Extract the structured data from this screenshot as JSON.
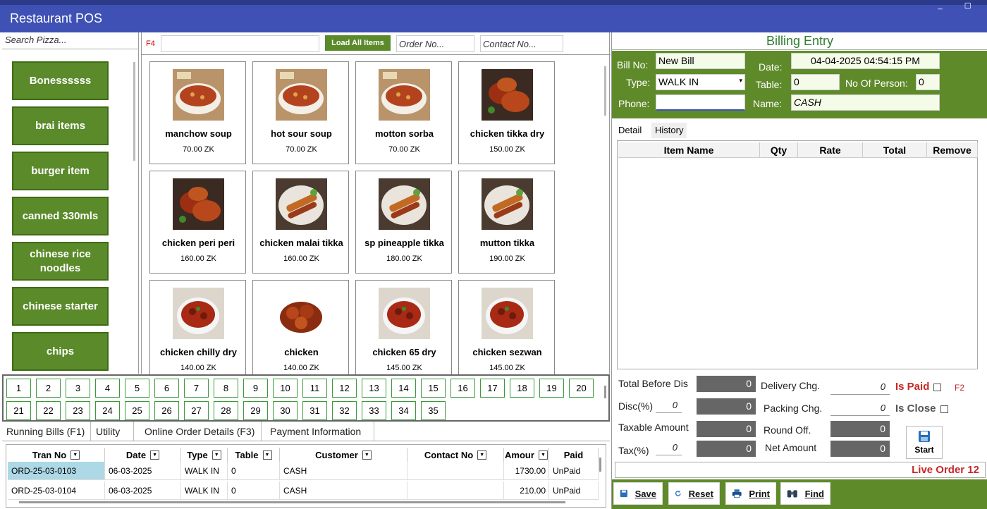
{
  "app": {
    "title": "Restaurant POS"
  },
  "categories": {
    "search_placeholder": "Search Pizza...",
    "items": [
      "Bonessssss",
      "brai items",
      "burger item",
      "canned 330mls",
      "chinese rice noodles",
      "chinese starter",
      "chips"
    ]
  },
  "items_toolbar": {
    "f4_label": "F4",
    "load_all_label": "Load All Items",
    "order_no_placeholder": "Order No...",
    "contact_no_placeholder": "Contact No..."
  },
  "menu_items": [
    {
      "name": "manchow soup",
      "price": "70.00 ZK",
      "icon": "soup-bowl"
    },
    {
      "name": "hot sour soup",
      "price": "70.00 ZK",
      "icon": "soup-bowl"
    },
    {
      "name": "motton sorba",
      "price": "70.00 ZK",
      "icon": "soup-bowl"
    },
    {
      "name": "chicken tikka dry",
      "price": "150.00 ZK",
      "icon": "grilled-chicken"
    },
    {
      "name": "chicken peri peri",
      "price": "160.00 ZK",
      "icon": "grilled-chicken"
    },
    {
      "name": "chicken malai tikka",
      "price": "160.00 ZK",
      "icon": "skewer-plate"
    },
    {
      "name": "sp pineapple tikka",
      "price": "180.00 ZK",
      "icon": "skewer-plate"
    },
    {
      "name": "mutton tikka",
      "price": "190.00 ZK",
      "icon": "skewer-plate"
    },
    {
      "name": "chicken chilly dry",
      "price": "140.00 ZK",
      "icon": "curry-bowl"
    },
    {
      "name": "chicken",
      "price": "140.00 ZK",
      "icon": "fried-chicken"
    },
    {
      "name": "chicken 65 dry",
      "price": "145.00 ZK",
      "icon": "curry-bowl"
    },
    {
      "name": "chicken sezwan",
      "price": "145.00 ZK",
      "icon": "curry-bowl"
    }
  ],
  "tables": [
    "1",
    "2",
    "3",
    "4",
    "5",
    "6",
    "7",
    "8",
    "9",
    "10",
    "11",
    "12",
    "13",
    "14",
    "15",
    "16",
    "17",
    "18",
    "19",
    "20",
    "21",
    "22",
    "23",
    "24",
    "25",
    "26",
    "27",
    "28",
    "29",
    "30",
    "31",
    "32",
    "33",
    "34",
    "35"
  ],
  "bottom_tabs": [
    "Running Bills (F1)",
    "Utility",
    "Online Order Details (F3)",
    "Payment Information"
  ],
  "running_bills": {
    "headers": [
      "Tran No",
      "Date",
      "Type",
      "Table",
      "Customer",
      "Contact No",
      "Amour",
      "Paid"
    ],
    "rows": [
      [
        "ORD-25-03-0103",
        "06-03-2025",
        "WALK IN",
        "0",
        "CASH",
        "",
        "1730.00",
        "UnPaid"
      ],
      [
        "ORD-25-03-0104",
        "06-03-2025",
        "WALK IN",
        "0",
        "CASH",
        "",
        "210.00",
        "UnPaid"
      ]
    ]
  },
  "billing": {
    "heading": "Billing Entry",
    "labels": {
      "bill_no": "Bill No:",
      "type": "Type:",
      "phone": "Phone:",
      "date": "Date:",
      "table": "Table:",
      "name": "Name:",
      "persons": "No Of Person:"
    },
    "values": {
      "bill_no": "New Bill",
      "type": "WALK IN",
      "phone": "",
      "date": "04-04-2025 04:54:15 PM",
      "table": "0",
      "name": "CASH",
      "persons": "0"
    },
    "detail_tabs": [
      "Detail",
      "History"
    ],
    "detail_headers": [
      "Item Name",
      "Qty",
      "Rate",
      "Total",
      "Remove"
    ],
    "totals": {
      "total_before_dis_label": "Total Before Dis",
      "total_before_dis": "0",
      "disc_label": "Disc(%)",
      "disc_input": "0",
      "disc": "0",
      "taxable_label": "Taxable Amount",
      "taxable": "0",
      "tax_label": "Tax(%)",
      "tax_input": "0",
      "tax": "0",
      "delivery_label": "Delivery Chg.",
      "delivery": "0",
      "packing_label": "Packing Chg.",
      "packing": "0",
      "round_label": "Round Off.",
      "round": "0",
      "net_label": "Net Amount",
      "net": "0"
    },
    "flags": {
      "is_paid": "Is Paid",
      "is_paid_key": "F2",
      "is_close": "Is Close"
    },
    "start_label": "Start",
    "live_order": "Live Order 12",
    "footer_buttons": [
      "Save",
      "Reset",
      "Print",
      "Find"
    ]
  },
  "colors": {
    "header_blue": "#3f51b5",
    "brand_green": "#5a8a2a",
    "alert_red": "#c62828"
  }
}
